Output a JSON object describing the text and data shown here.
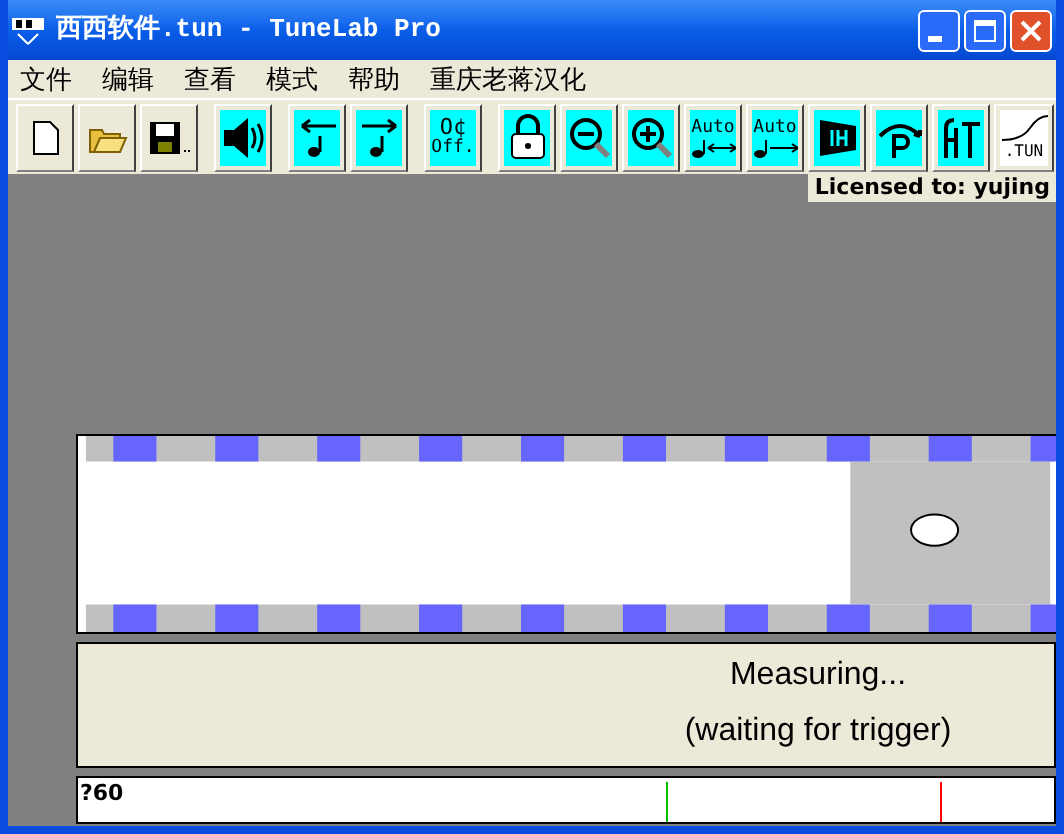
{
  "window": {
    "title": "西西软件.tun - TuneLab Pro"
  },
  "menu": [
    "文件",
    "编辑",
    "查看",
    "模式",
    "帮助",
    "重庆老蒋汉化"
  ],
  "toolbar": [
    [
      {
        "kind": "new"
      },
      {
        "kind": "open"
      },
      {
        "kind": "save"
      }
    ],
    [
      {
        "kind": "speaker"
      }
    ],
    [
      {
        "kind": "note-left"
      },
      {
        "kind": "note-right"
      }
    ],
    [
      {
        "kind": "offset",
        "label": "O¢",
        "sublabel": "Off."
      }
    ],
    [
      {
        "kind": "lock"
      },
      {
        "kind": "zoom-out"
      },
      {
        "kind": "zoom-in"
      },
      {
        "kind": "auto-both",
        "label": "Auto"
      },
      {
        "kind": "auto-right",
        "label": "Auto"
      },
      {
        "kind": "ih"
      },
      {
        "kind": "p-arc"
      },
      {
        "kind": "ht"
      },
      {
        "kind": "tun-curve",
        "label": ".TUN"
      }
    ]
  ],
  "license": "Licensed to: yujing",
  "message": {
    "line1": "Measuring...",
    "line2": "(waiting for trigger)"
  },
  "ruler": {
    "label": "?60"
  }
}
